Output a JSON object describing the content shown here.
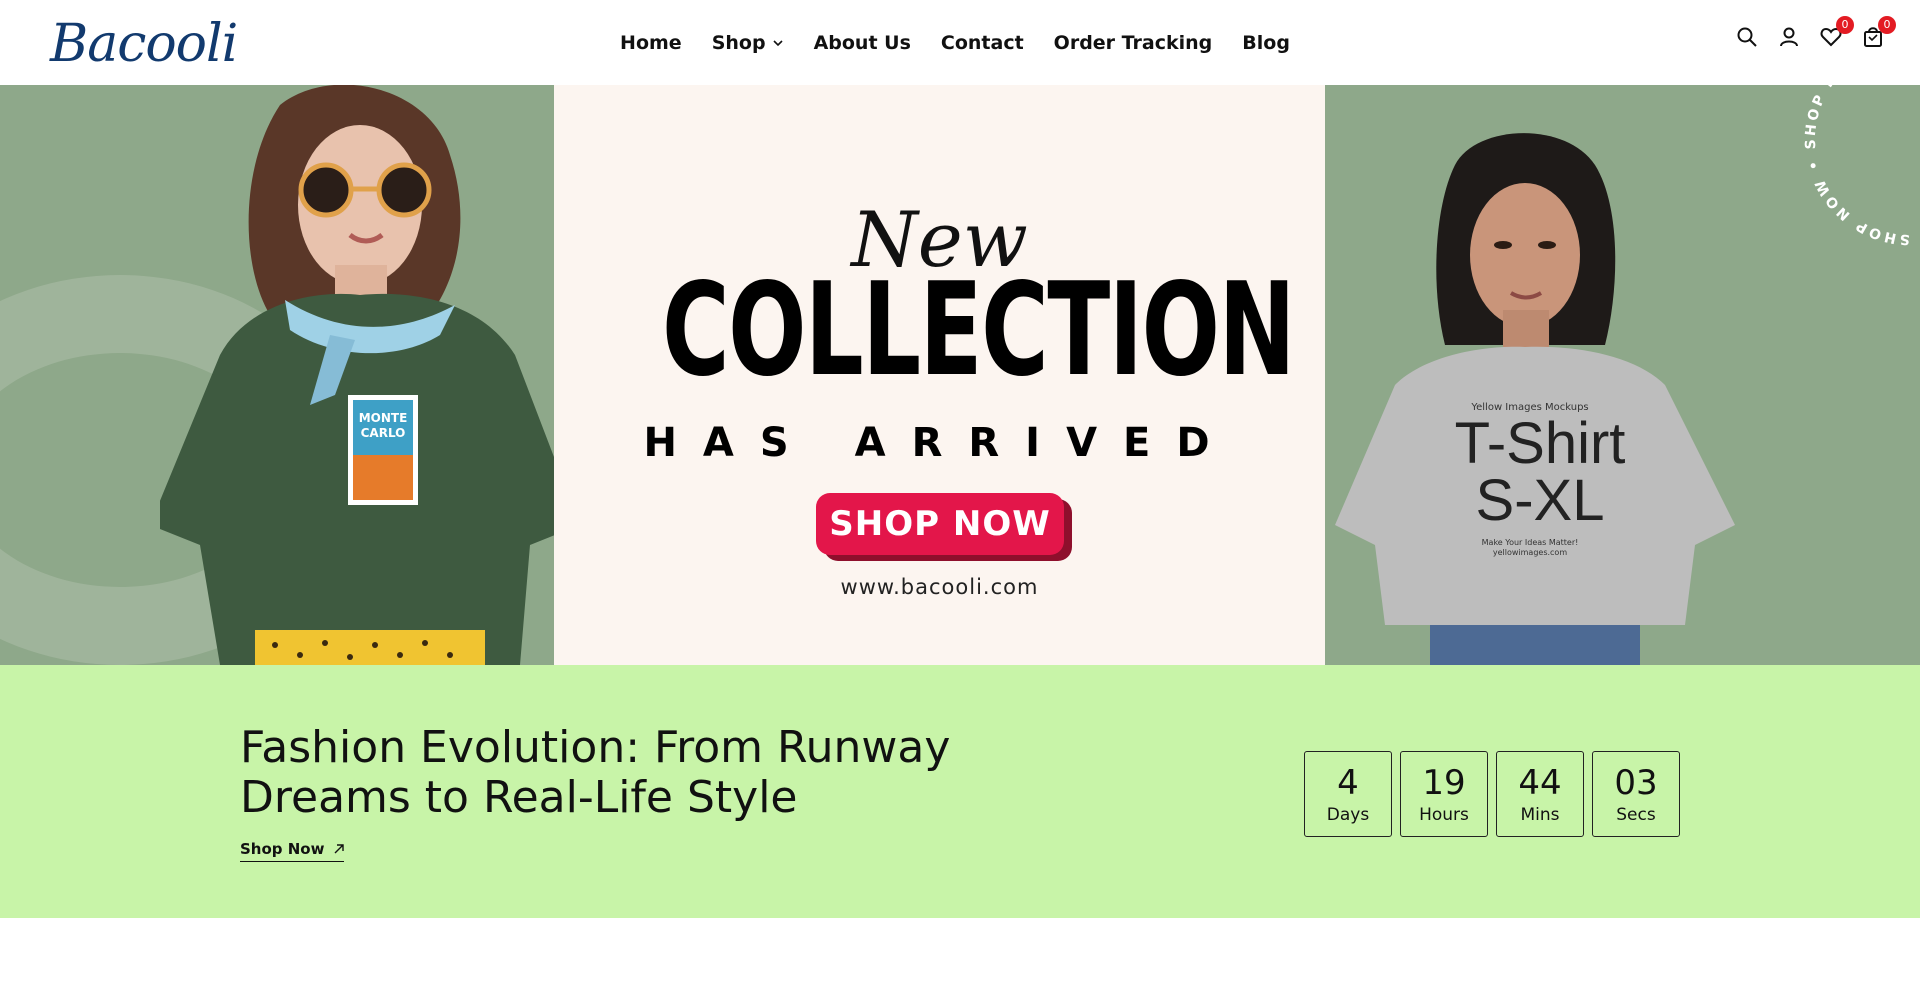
{
  "header": {
    "logo": "Bacooli",
    "nav": [
      {
        "label": "Home"
      },
      {
        "label": "Shop",
        "has_dropdown": true
      },
      {
        "label": "About Us"
      },
      {
        "label": "Contact"
      },
      {
        "label": "Order Tracking"
      },
      {
        "label": "Blog"
      }
    ],
    "icons": {
      "search": "search-icon",
      "account": "user-icon",
      "wishlist": "heart-icon",
      "cart": "cart-icon"
    },
    "wishlist_count": "0",
    "cart_count": "0"
  },
  "hero": {
    "script_word": "New",
    "headline": "COLLECTION",
    "subheadline": "HAS ARRIVED",
    "cta": "SHOP NOW",
    "url": "www.bacooli.com",
    "circular_text": "SHOP NOW • SHOP NOW •",
    "left_tee": {
      "line1": "MONTE",
      "line2": "CARLO"
    },
    "right_tee": {
      "brand": "Yellow Images Mockups",
      "line1": "T-Shirt",
      "line2": "S-XL",
      "small1": "Make Your Ideas Matter!",
      "small2": "yellowimages.com"
    },
    "colors": {
      "panel": "#8ea88a",
      "center_bg": "#fcf5f0",
      "cta": "#e3164a"
    }
  },
  "promo": {
    "headline_line1": "Fashion Evolution: From Runway",
    "headline_line2": "Dreams to Real-Life Style",
    "link": "Shop Now",
    "countdown": [
      {
        "value": "4",
        "unit": "Days"
      },
      {
        "value": "19",
        "unit": "Hours"
      },
      {
        "value": "44",
        "unit": "Mins"
      },
      {
        "value": "03",
        "unit": "Secs"
      }
    ],
    "bg_color": "#c8f4a8"
  }
}
